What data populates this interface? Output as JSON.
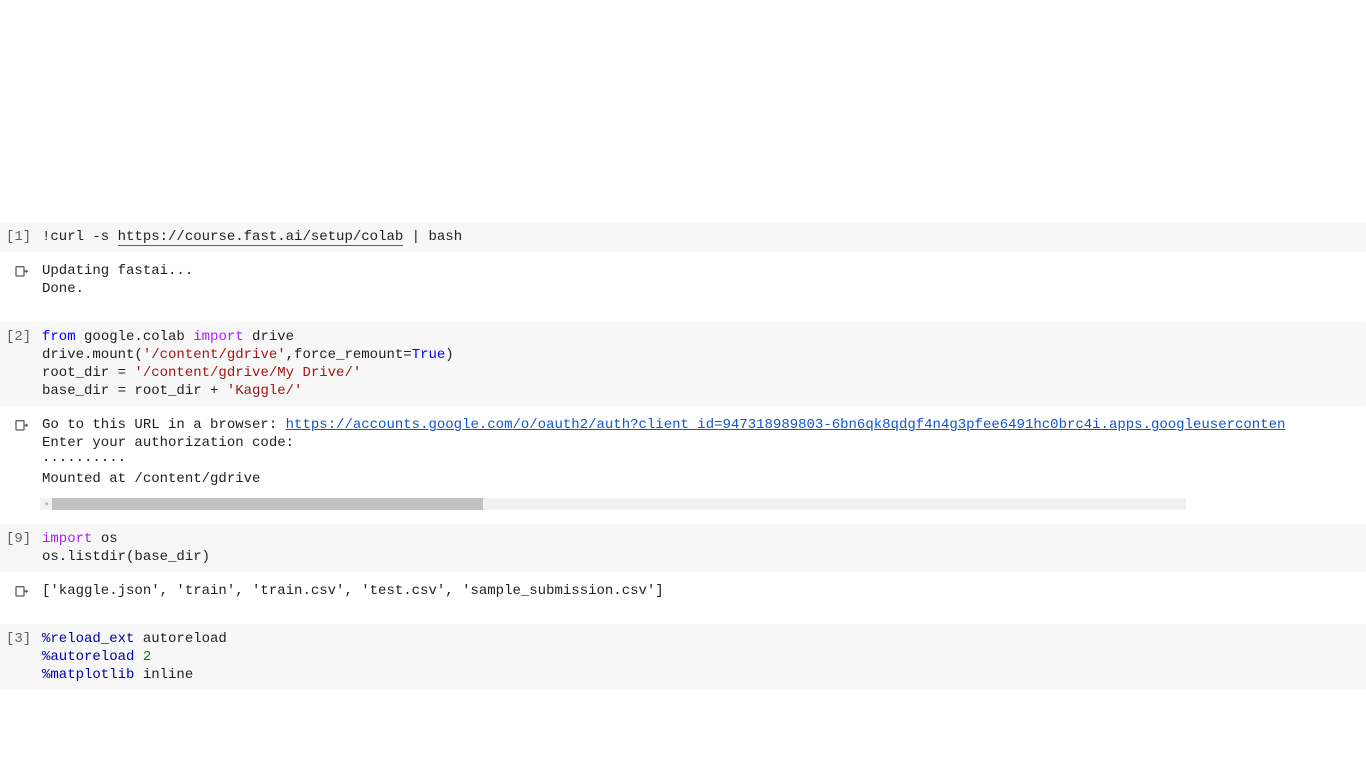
{
  "cells": [
    {
      "prompt": "[1]",
      "code": {
        "pre": "!curl -s ",
        "link": "https://course.fast.ai/setup/colab",
        "post": " | bash"
      },
      "output": "Updating fastai...\nDone."
    },
    {
      "prompt": "[2]",
      "code_lines": {
        "l1_from": "from",
        "l1_mod": " google.colab ",
        "l1_import": "import",
        "l1_name": " drive",
        "l2_a": "drive.mount(",
        "l2_s": "'/content/gdrive'",
        "l2_b": ",force_remount=",
        "l2_true": "True",
        "l2_c": ")",
        "l3_a": "root_dir = ",
        "l3_s": "'/content/gdrive/My Drive/'",
        "l4_a": "base_dir = root_dir + ",
        "l4_s": "'Kaggle/'"
      },
      "output": {
        "pre": "Go to this URL in a browser: ",
        "link": "https://accounts.google.com/o/oauth2/auth?client_id=947318989803-6bn6qk8qdgf4n4g3pfee6491hc0brc4i.apps.googleuserconten",
        "rest": "\nEnter your authorization code:\n··········\nMounted at /content/gdrive"
      }
    },
    {
      "prompt": "[9]",
      "code_lines": {
        "l1_import": "import",
        "l1_name": " os",
        "l2": "os.listdir(base_dir)"
      },
      "output": "['kaggle.json', 'train', 'train.csv', 'test.csv', 'sample_submission.csv']"
    },
    {
      "prompt": "[3]",
      "code_lines": {
        "l1_m": "%reload_ext",
        "l1_a": " autoreload",
        "l2_m": "%autoreload",
        "l2_n": " 2",
        "l3_m": "%matplotlib",
        "l3_a": " inline"
      }
    }
  ]
}
